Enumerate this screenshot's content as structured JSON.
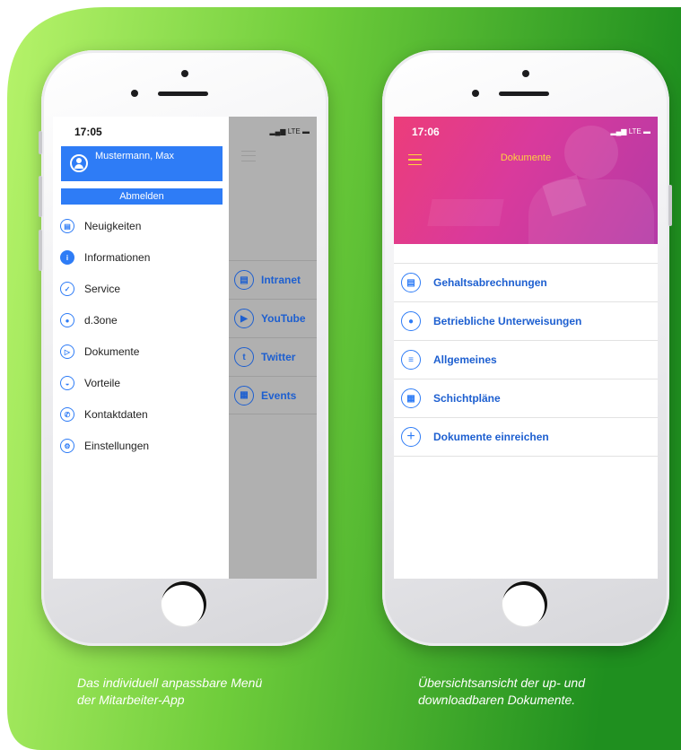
{
  "left_phone": {
    "time": "17:05",
    "status": "LTE",
    "user_name": "Mustermann, Max",
    "logout_label": "Abmelden",
    "menu": [
      {
        "label": "Neuigkeiten",
        "icon": "newspaper-icon"
      },
      {
        "label": "Informationen",
        "icon": "info-icon"
      },
      {
        "label": "Service",
        "icon": "checkbox-icon"
      },
      {
        "label": "d.3one",
        "icon": "people-icon"
      },
      {
        "label": "Dokumente",
        "icon": "document-icon"
      },
      {
        "label": "Vorteile",
        "icon": "gift-icon"
      },
      {
        "label": "Kontaktdaten",
        "icon": "phone-icon"
      },
      {
        "label": "Einstellungen",
        "icon": "settings-icon"
      }
    ],
    "external_links": [
      {
        "label": "Intranet",
        "icon": "newspaper-icon"
      },
      {
        "label": "YouTube",
        "icon": "youtube-icon"
      },
      {
        "label": "Twitter",
        "icon": "twitter-icon"
      },
      {
        "label": "Events",
        "icon": "calendar-icon"
      }
    ]
  },
  "right_phone": {
    "time": "17:06",
    "status": "LTE",
    "title": "Dokumente",
    "documents": [
      {
        "label": "Gehaltsabrechnungen",
        "icon": "payslip-icon"
      },
      {
        "label": "Betriebliche Unterweisungen",
        "icon": "lightbulb-icon"
      },
      {
        "label": "Allgemeines",
        "icon": "document-icon"
      },
      {
        "label": "Schichtpläne",
        "icon": "calendar-icon"
      },
      {
        "label": "Dokumente einreichen",
        "icon": "plus-icon"
      }
    ]
  },
  "captions": {
    "left_line1": "Das individuell anpassbare Menü",
    "left_line2": "der Mitarbeiter-App",
    "right_line1": "Übersichtsansicht der up- und",
    "right_line2": "downloadbaren Dokumente."
  },
  "colors": {
    "accent_blue": "#2e7cf6",
    "gradient_start": "#b6f36a",
    "gradient_end": "#1f8f1f",
    "hero_pink": "#ec3d7a",
    "hero_title_yellow": "#ffd23f"
  }
}
